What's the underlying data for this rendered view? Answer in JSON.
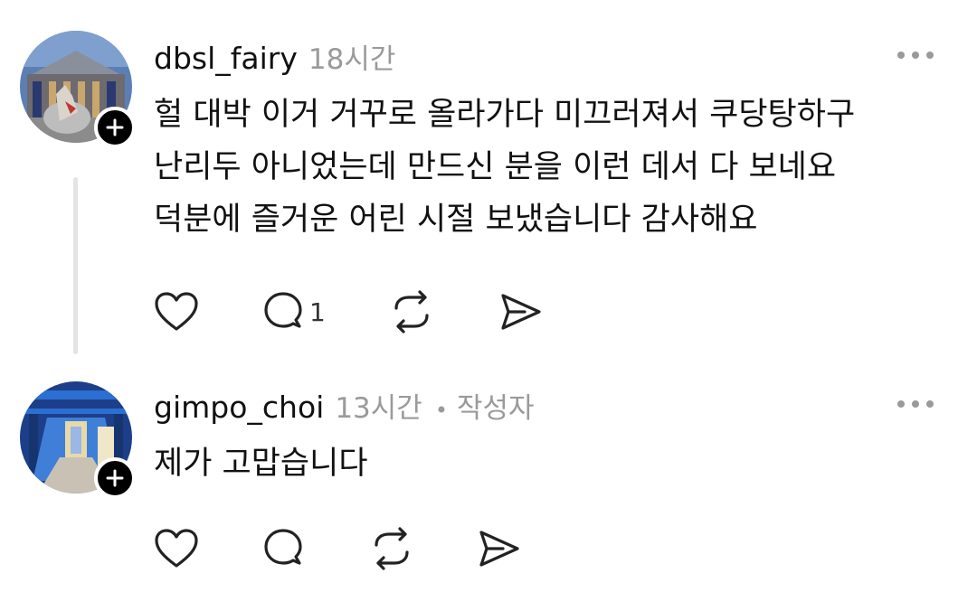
{
  "comments": [
    {
      "username": "dbsl_fairy",
      "time": "18시간",
      "author_tag": "",
      "lines": [
        "헐 대박 이거 거꾸로 올라가다 미끄러져서 쿠당탕하구",
        "난리두 아니었는데 만드신 분을 이런 데서 다 보네요",
        "덕분에 즐거운 어린 시절 보냈습니다 감사해요"
      ],
      "reply_count": "1",
      "icons": [
        "heart-icon",
        "comment-icon",
        "repost-icon",
        "share-icon",
        "more-icon",
        "plus-icon"
      ]
    },
    {
      "username": "gimpo_choi",
      "time": "13시간",
      "separator": "•",
      "author_tag": "작성자",
      "lines": [
        "제가 고맙습니다"
      ],
      "reply_count": "",
      "icons": [
        "heart-icon",
        "comment-icon",
        "repost-icon",
        "share-icon",
        "more-icon",
        "plus-icon"
      ]
    }
  ],
  "colors": {
    "text": "#111111",
    "muted": "#9a9a9a",
    "thread_line": "#e4e4e4",
    "follow_button": "#000000"
  }
}
